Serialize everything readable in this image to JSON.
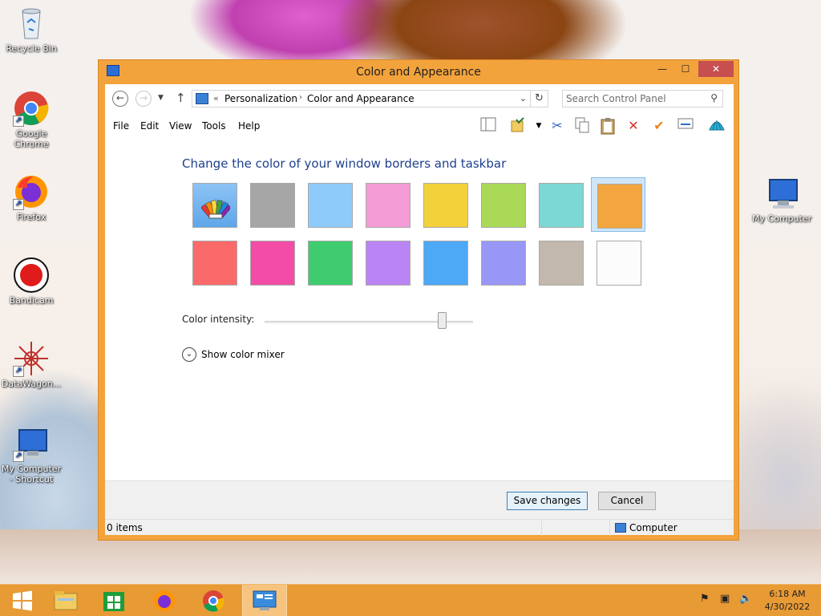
{
  "desktop": {
    "icons": [
      {
        "label": "Recycle Bin"
      },
      {
        "label": "Google Chrome"
      },
      {
        "label": "Firefox"
      },
      {
        "label": "Bandicam"
      },
      {
        "label": "DataWagon..."
      },
      {
        "label": "My Computer - Shortcut"
      },
      {
        "label": "My Computer"
      }
    ]
  },
  "window": {
    "title": "Color and Appearance",
    "controls": {
      "minimize": "—",
      "maximize": "☐",
      "close": "✕"
    }
  },
  "address": {
    "prefix": "«",
    "crumbs": [
      "Personalization",
      "Color and Appearance"
    ],
    "search_placeholder": "Search Control Panel"
  },
  "menu": [
    "File",
    "Edit",
    "View",
    "Tools",
    "Help"
  ],
  "content": {
    "heading": "Change the color of your window borders and taskbar",
    "swatches_row1": [
      "automatic",
      "#a6a6a6",
      "#8ecbfb",
      "#f49cd6",
      "#f3d13b",
      "#a9d956",
      "#7bd8d4",
      "#f3a53f"
    ],
    "swatches_row2": [
      "#fb6a6a",
      "#f34ca6",
      "#3fcc6f",
      "#bb84f4",
      "#4da8f6",
      "#9997f6",
      "#c3b8ad",
      "#fcfcfc"
    ],
    "selected_swatch": "#f3a53f",
    "intensity_label": "Color intensity:",
    "intensity_value": 0.85,
    "mixer_label": "Show color mixer"
  },
  "buttons": {
    "save": "Save changes",
    "cancel": "Cancel"
  },
  "status": {
    "items": "0 items",
    "location": "Computer"
  },
  "taskbar": {
    "time": "6:18 AM",
    "date": "4/30/2022"
  },
  "colors": {
    "accent": "#f3a53f",
    "heading": "#1e3f8c"
  }
}
